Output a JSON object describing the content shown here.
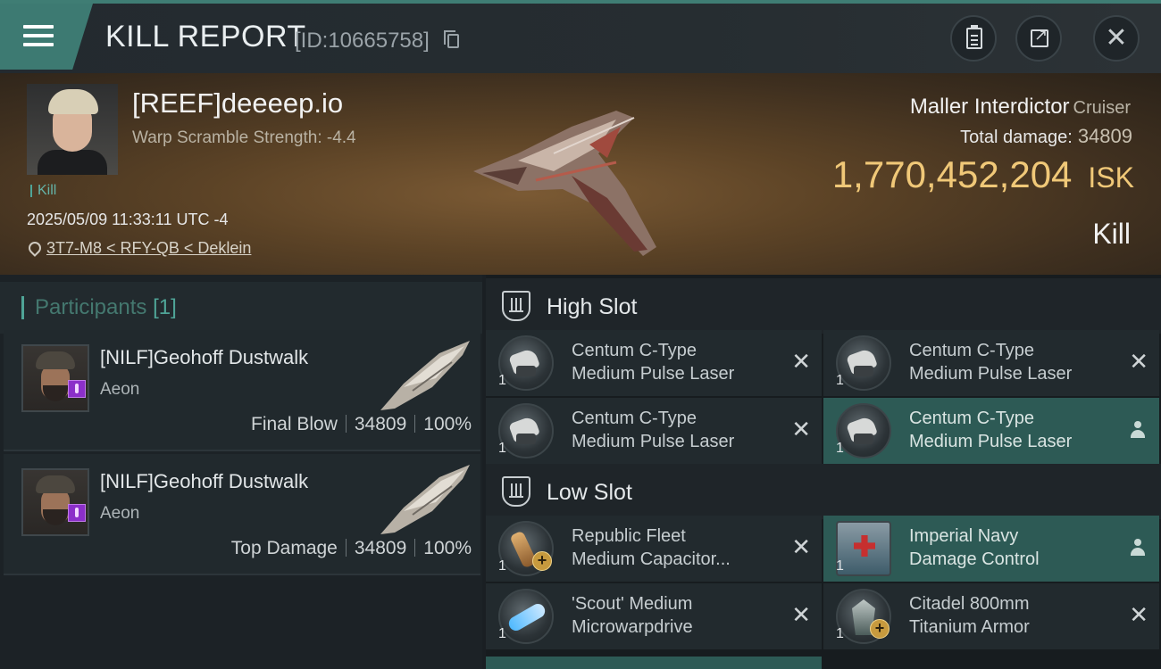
{
  "header": {
    "title": "KILL REPORT",
    "kill_id": "[ID:10665758]"
  },
  "victim": {
    "name": "[REEF]deeeep.io",
    "warp_scramble": "Warp Scramble Strength: -4.4",
    "tag": "Kill",
    "timestamp": "2025/05/09 11:33:11 UTC -4",
    "location": "3T7-M8 < RFY-QB < Deklein",
    "ship": "Maller Interdictor",
    "ship_class": "Cruiser",
    "total_damage_label": "Total damage:",
    "total_damage": "34809",
    "isk_value": "1,770,452,204",
    "isk_unit": "ISK",
    "result": "Kill"
  },
  "participants": {
    "label": "Participants",
    "count": "[1]",
    "rows": [
      {
        "name": "[NILF]Geohoff Dustwalk",
        "ship": "Aeon",
        "role": "Final Blow",
        "damage": "34809",
        "percent": "100%"
      },
      {
        "name": "[NILF]Geohoff Dustwalk",
        "ship": "Aeon",
        "role": "Top Damage",
        "damage": "34809",
        "percent": "100%"
      }
    ]
  },
  "fittings": {
    "high_slot": {
      "label": "High Slot",
      "modules": [
        {
          "qty": "1",
          "line1": "Centum C-Type",
          "line2": "Medium Pulse Laser",
          "status": "destroyed"
        },
        {
          "qty": "1",
          "line1": "Centum C-Type",
          "line2": "Medium Pulse Laser",
          "status": "destroyed"
        },
        {
          "qty": "1",
          "line1": "Centum C-Type",
          "line2": "Medium Pulse Laser",
          "status": "destroyed"
        },
        {
          "qty": "1",
          "line1": "Centum C-Type",
          "line2": "Medium Pulse Laser",
          "status": "dropped"
        }
      ]
    },
    "low_slot": {
      "label": "Low Slot",
      "modules": [
        {
          "qty": "1",
          "line1": "Republic Fleet",
          "line2": "Medium Capacitor...",
          "status": "destroyed"
        },
        {
          "qty": "1",
          "line1": "Imperial Navy",
          "line2": "Damage Control",
          "status": "dropped"
        },
        {
          "qty": "1",
          "line1": "'Scout' Medium",
          "line2": "Microwarpdrive",
          "status": "destroyed"
        },
        {
          "qty": "1",
          "line1": "Citadel 800mm",
          "line2": "Titanium Armor",
          "status": "destroyed"
        }
      ]
    }
  },
  "icons": {
    "menu": "hamburger-icon",
    "copy": "copy-icon",
    "clipboard": "clipboard-icon",
    "export": "export-icon",
    "close": "close-icon",
    "location": "pin-icon",
    "destroyed": "x-icon",
    "dropped": "person-icon"
  },
  "colors": {
    "accent": "#3f7d74",
    "isk": "#f0c878",
    "highlight_row": "#2d5a55",
    "corp_badge": "#8b2fc9"
  }
}
